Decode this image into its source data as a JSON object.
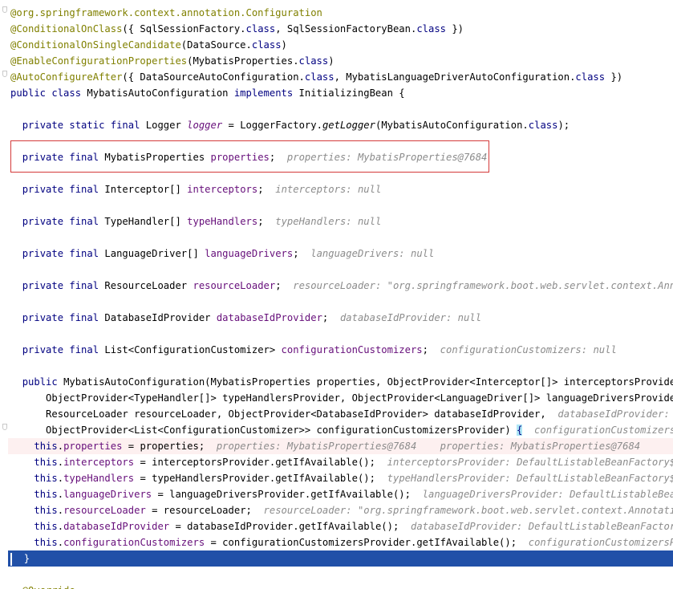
{
  "lines": [
    {
      "indent": "",
      "tokens": [
        {
          "t": "@org.springframework.context.annotation.",
          "c": "an"
        },
        {
          "t": "Configuration",
          "c": "an"
        }
      ]
    },
    {
      "indent": "",
      "tokens": [
        {
          "t": "@ConditionalOnClass",
          "c": "an"
        },
        {
          "t": "({ SqlSessionFactory.",
          "c": ""
        },
        {
          "t": "class",
          "c": "kw"
        },
        {
          "t": ", SqlSessionFactoryBean.",
          "c": ""
        },
        {
          "t": "class",
          "c": "kw"
        },
        {
          "t": " })",
          "c": ""
        }
      ]
    },
    {
      "indent": "",
      "tokens": [
        {
          "t": "@ConditionalOnSingleCandidate",
          "c": "an"
        },
        {
          "t": "(DataSource.",
          "c": ""
        },
        {
          "t": "class",
          "c": "kw"
        },
        {
          "t": ")",
          "c": ""
        }
      ]
    },
    {
      "indent": "",
      "tokens": [
        {
          "t": "@EnableConfigurationProperties",
          "c": "an"
        },
        {
          "t": "(MybatisProperties.",
          "c": ""
        },
        {
          "t": "class",
          "c": "kw"
        },
        {
          "t": ")",
          "c": ""
        }
      ]
    },
    {
      "indent": "",
      "tokens": [
        {
          "t": "@AutoConfigureAfter",
          "c": "an"
        },
        {
          "t": "({ DataSourceAutoConfiguration.",
          "c": ""
        },
        {
          "t": "class",
          "c": "kw"
        },
        {
          "t": ", MybatisLanguageDriverAutoConfiguration.",
          "c": ""
        },
        {
          "t": "class",
          "c": "kw"
        },
        {
          "t": " })",
          "c": ""
        }
      ]
    },
    {
      "indent": "",
      "tokens": [
        {
          "t": "public class ",
          "c": "kw"
        },
        {
          "t": "MybatisAutoConfiguration ",
          "c": ""
        },
        {
          "t": "implements ",
          "c": "kw"
        },
        {
          "t": "InitializingBean {",
          "c": ""
        }
      ]
    },
    {
      "indent": "",
      "tokens": []
    },
    {
      "indent": "  ",
      "tokens": [
        {
          "t": "private static final ",
          "c": "kw"
        },
        {
          "t": "Logger ",
          "c": ""
        },
        {
          "t": "logger",
          "c": "sfld"
        },
        {
          "t": " = LoggerFactory.",
          "c": ""
        },
        {
          "t": "getLogger",
          "c": "mth"
        },
        {
          "t": "(MybatisAutoConfiguration.",
          "c": ""
        },
        {
          "t": "class",
          "c": "kw"
        },
        {
          "t": ");",
          "c": ""
        }
      ]
    },
    {
      "indent": "",
      "tokens": []
    },
    {
      "indent": "  ",
      "tokens": [
        {
          "t": "private final ",
          "c": "kw"
        },
        {
          "t": "MybatisProperties ",
          "c": ""
        },
        {
          "t": "properties",
          "c": "fld"
        },
        {
          "t": ";  ",
          "c": ""
        },
        {
          "t": "properties: MybatisProperties@7684",
          "c": "hint"
        }
      ]
    },
    {
      "indent": "",
      "tokens": []
    },
    {
      "indent": "  ",
      "tokens": [
        {
          "t": "private final ",
          "c": "kw"
        },
        {
          "t": "Interceptor[] ",
          "c": ""
        },
        {
          "t": "interceptors",
          "c": "fld"
        },
        {
          "t": ";  ",
          "c": ""
        },
        {
          "t": "interceptors: null",
          "c": "hint"
        }
      ]
    },
    {
      "indent": "",
      "tokens": []
    },
    {
      "indent": "  ",
      "tokens": [
        {
          "t": "private final ",
          "c": "kw"
        },
        {
          "t": "TypeHandler[] ",
          "c": ""
        },
        {
          "t": "typeHandlers",
          "c": "fld"
        },
        {
          "t": ";  ",
          "c": ""
        },
        {
          "t": "typeHandlers: null",
          "c": "hint"
        }
      ]
    },
    {
      "indent": "",
      "tokens": []
    },
    {
      "indent": "  ",
      "tokens": [
        {
          "t": "private final ",
          "c": "kw"
        },
        {
          "t": "LanguageDriver[] ",
          "c": ""
        },
        {
          "t": "languageDrivers",
          "c": "fld"
        },
        {
          "t": ";  ",
          "c": ""
        },
        {
          "t": "languageDrivers: null",
          "c": "hint"
        }
      ]
    },
    {
      "indent": "",
      "tokens": []
    },
    {
      "indent": "  ",
      "tokens": [
        {
          "t": "private final ",
          "c": "kw"
        },
        {
          "t": "ResourceLoader ",
          "c": ""
        },
        {
          "t": "resourceLoader",
          "c": "fld"
        },
        {
          "t": ";  ",
          "c": ""
        },
        {
          "t": "resourceLoader: \"org.springframework.boot.web.servlet.context.Annotati",
          "c": "hint"
        }
      ]
    },
    {
      "indent": "",
      "tokens": []
    },
    {
      "indent": "  ",
      "tokens": [
        {
          "t": "private final ",
          "c": "kw"
        },
        {
          "t": "DatabaseIdProvider ",
          "c": ""
        },
        {
          "t": "databaseIdProvider",
          "c": "fld"
        },
        {
          "t": ";  ",
          "c": ""
        },
        {
          "t": "databaseIdProvider: null",
          "c": "hint"
        }
      ]
    },
    {
      "indent": "",
      "tokens": []
    },
    {
      "indent": "  ",
      "tokens": [
        {
          "t": "private final ",
          "c": "kw"
        },
        {
          "t": "List<ConfigurationCustomizer> ",
          "c": ""
        },
        {
          "t": "configurationCustomizers",
          "c": "fld"
        },
        {
          "t": ";  ",
          "c": ""
        },
        {
          "t": "configurationCustomizers: null",
          "c": "hint"
        }
      ]
    },
    {
      "indent": "",
      "tokens": []
    },
    {
      "indent": "  ",
      "tokens": [
        {
          "t": "public ",
          "c": "kw"
        },
        {
          "t": "MybatisAutoConfiguration",
          "c": ""
        },
        {
          "t": "(MybatisProperties properties, ObjectProvider<Interceptor[]> interceptorsProvider,  ",
          "c": ""
        },
        {
          "t": "i",
          "c": "hint"
        }
      ]
    },
    {
      "indent": "      ",
      "tokens": [
        {
          "t": "ObjectProvider<TypeHandler[]> typeHandlersProvider, ObjectProvider<LanguageDriver[]> languageDriversProvider,  ",
          "c": ""
        },
        {
          "t": "l",
          "c": "hint"
        }
      ]
    },
    {
      "indent": "      ",
      "tokens": [
        {
          "t": "ResourceLoader resourceLoader, ObjectProvider<DatabaseIdProvider> databaseIdProvider,  ",
          "c": ""
        },
        {
          "t": "databaseIdProvider: Defau",
          "c": "hint"
        }
      ]
    },
    {
      "indent": "      ",
      "tokens": [
        {
          "t": "ObjectProvider<List<ConfigurationCustomizer>> configurationCustomizersProvider) ",
          "c": ""
        },
        {
          "t": "{",
          "c": "brace"
        },
        {
          "t": "  configurationCustomizersProvi",
          "c": "hint"
        }
      ]
    },
    {
      "indent": "    ",
      "hl": "pink",
      "tokens": [
        {
          "t": "this",
          "c": "kw"
        },
        {
          "t": ".",
          "c": ""
        },
        {
          "t": "properties",
          "c": "fld"
        },
        {
          "t": " = properties;  ",
          "c": ""
        },
        {
          "t": "properties: MybatisProperties@7684    properties: MybatisProperties@7684",
          "c": "hint"
        }
      ]
    },
    {
      "indent": "    ",
      "tokens": [
        {
          "t": "this",
          "c": "kw"
        },
        {
          "t": ".",
          "c": ""
        },
        {
          "t": "interceptors",
          "c": "fld"
        },
        {
          "t": " = interceptorsProvider.getIfAvailable();  ",
          "c": ""
        },
        {
          "t": "interceptorsProvider: DefaultListableBeanFactory$Deper",
          "c": "hint"
        }
      ]
    },
    {
      "indent": "    ",
      "tokens": [
        {
          "t": "this",
          "c": "kw"
        },
        {
          "t": ".",
          "c": ""
        },
        {
          "t": "typeHandlers",
          "c": "fld"
        },
        {
          "t": " = typeHandlersProvider.getIfAvailable();  ",
          "c": ""
        },
        {
          "t": "typeHandlersProvider: DefaultListableBeanFactory$Depe",
          "c": "hint"
        }
      ]
    },
    {
      "indent": "    ",
      "tokens": [
        {
          "t": "this",
          "c": "kw"
        },
        {
          "t": ".",
          "c": ""
        },
        {
          "t": "languageDrivers",
          "c": "fld"
        },
        {
          "t": " = languageDriversProvider.getIfAvailable();  ",
          "c": ""
        },
        {
          "t": "languageDriversProvider: DefaultListableBeanFact",
          "c": "hint"
        }
      ]
    },
    {
      "indent": "    ",
      "tokens": [
        {
          "t": "this",
          "c": "kw"
        },
        {
          "t": ".",
          "c": ""
        },
        {
          "t": "resourceLoader",
          "c": "fld"
        },
        {
          "t": " = resourceLoader;  ",
          "c": ""
        },
        {
          "t": "resourceLoader: \"org.springframework.boot.web.servlet.context.AnnotationCon",
          "c": "hint"
        }
      ]
    },
    {
      "indent": "    ",
      "tokens": [
        {
          "t": "this",
          "c": "kw"
        },
        {
          "t": ".",
          "c": ""
        },
        {
          "t": "databaseIdProvider",
          "c": "fld"
        },
        {
          "t": " = databaseIdProvider.getIfAvailable();  ",
          "c": ""
        },
        {
          "t": "databaseIdProvider: DefaultListableBeanFactory$Dep",
          "c": "hint"
        }
      ]
    },
    {
      "indent": "    ",
      "tokens": [
        {
          "t": "this",
          "c": "kw"
        },
        {
          "t": ".",
          "c": ""
        },
        {
          "t": "configurationCustomizers",
          "c": "fld"
        },
        {
          "t": " = configurationCustomizersProvider.getIfAvailable();  ",
          "c": ""
        },
        {
          "t": "configurationCustomizersProvi",
          "c": "hint"
        }
      ]
    },
    {
      "indent": "  ",
      "hl": "caret",
      "tokens": [
        {
          "t": "}",
          "c": "brace"
        }
      ]
    },
    {
      "indent": "",
      "tokens": []
    },
    {
      "indent": "  ",
      "tokens": [
        {
          "t": "@Override",
          "c": "an"
        }
      ]
    }
  ],
  "boxed_line_index": 9,
  "colors": {
    "keyword": "#000080",
    "annotation": "#808000",
    "field": "#660e7a",
    "hint": "#8c8c8c",
    "highlight_box": "#d43a3a",
    "caret_line": "#2150a8",
    "debug_line": "#fdf0f0"
  }
}
